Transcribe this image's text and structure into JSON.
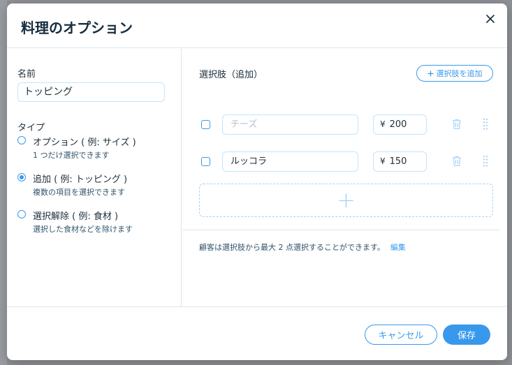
{
  "dialog": {
    "title": "料理のオプション",
    "close_icon": "close-icon"
  },
  "left": {
    "name_label": "名前",
    "name_value": "トッピング",
    "type_label": "タイプ",
    "types": [
      {
        "title": "オプション ( 例: サイズ )",
        "desc": "1 つだけ選択できます",
        "selected": false
      },
      {
        "title": "追加 ( 例: トッピング )",
        "desc": "複数の項目を選択できます",
        "selected": true
      },
      {
        "title": "選択解除 ( 例: 食材 )",
        "desc": "選択した食材などを除けます",
        "selected": false
      }
    ]
  },
  "right": {
    "section_label": "選択肢（追加）",
    "add_choice_label": "選択肢を追加",
    "choices": [
      {
        "name": "",
        "placeholder": "チーズ",
        "currency": "¥",
        "price": "200"
      },
      {
        "name": "ルッコラ",
        "placeholder": "",
        "currency": "¥",
        "price": "150"
      }
    ],
    "note": "顧客は選択肢から最大 2 点選択することができます。",
    "edit_label": "編集"
  },
  "footer": {
    "cancel_label": "キャンセル",
    "save_label": "保存"
  },
  "colors": {
    "accent": "#3899ec",
    "text": "#20303c",
    "border": "#c1e4fe"
  }
}
